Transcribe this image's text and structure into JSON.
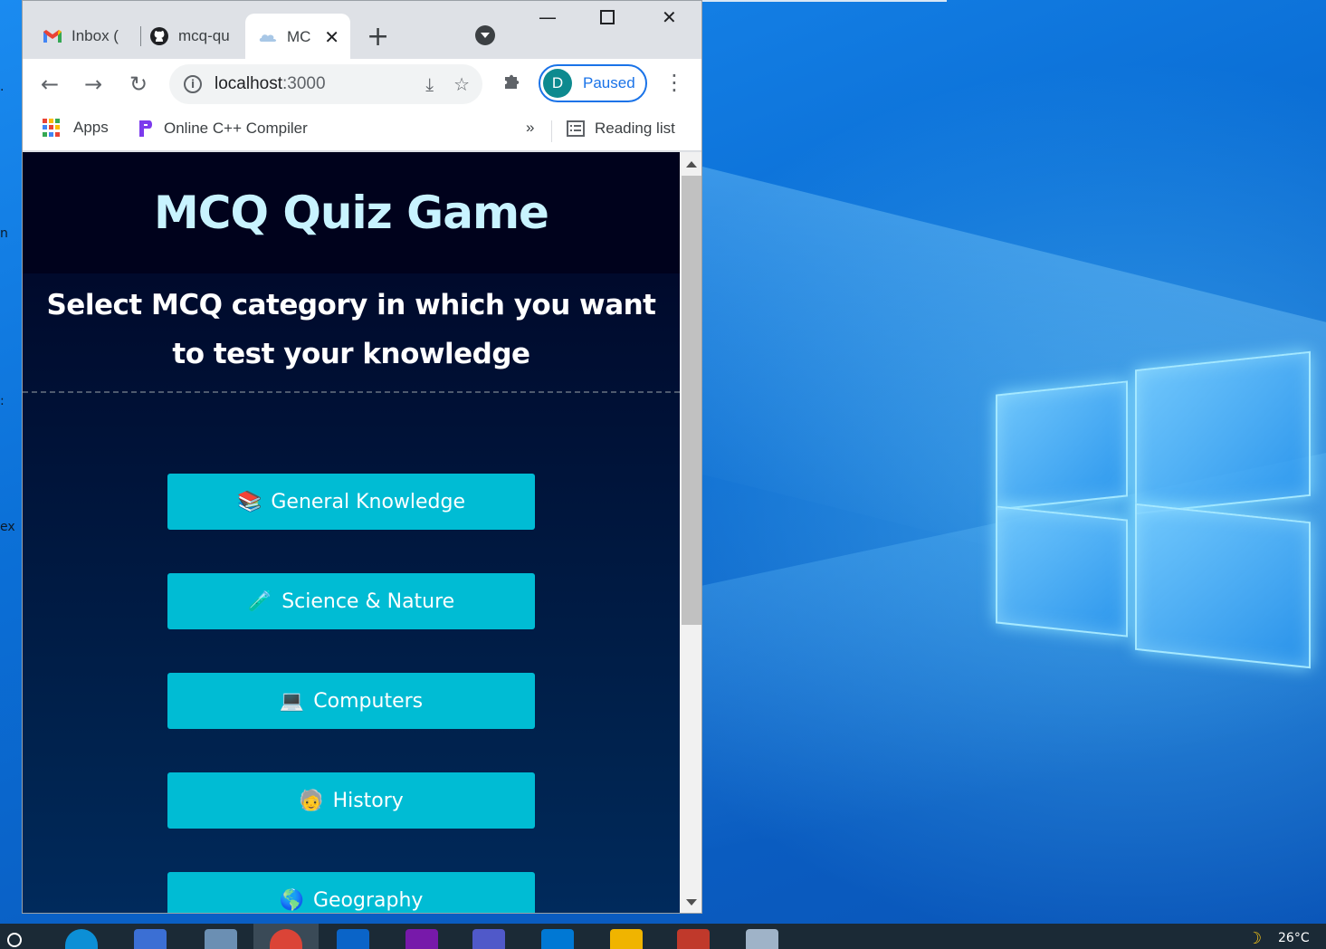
{
  "browser": {
    "tabs": [
      {
        "label": "Inbox (",
        "icon": "gmail-icon"
      },
      {
        "label": "mcq-qu",
        "icon": "github-icon"
      },
      {
        "label": "MC",
        "icon": "cloud-favicon-icon",
        "active": true
      }
    ],
    "new_tab": "+",
    "address": {
      "host": "localhost",
      "port": ":3000"
    },
    "profile": {
      "initial": "D",
      "status": "Paused"
    },
    "bookmarks": {
      "apps": "Apps",
      "compiler": "Online C++ Compiler",
      "overflow": "»",
      "reading_list": "Reading list"
    }
  },
  "page": {
    "title": "MCQ Quiz Game",
    "subtitle": "Select MCQ category in which you want to test your knowledge",
    "categories": [
      {
        "emoji": "📚",
        "label": "General Knowledge"
      },
      {
        "emoji": "🧪",
        "label": "Science & Nature"
      },
      {
        "emoji": "💻",
        "label": "Computers"
      },
      {
        "emoji": "🧓",
        "label": "History"
      },
      {
        "emoji": "🌎",
        "label": "Geography"
      }
    ]
  },
  "colors": {
    "button": "#00bcd4",
    "title": "#c8f3ff",
    "page_bg_top": "#000423",
    "page_bg_bottom": "#002a5c"
  },
  "taskbar": {
    "temperature": "26°C"
  },
  "desktop": {
    "edge_glyphs": [
      ".",
      "n",
      ":",
      "ex"
    ]
  }
}
